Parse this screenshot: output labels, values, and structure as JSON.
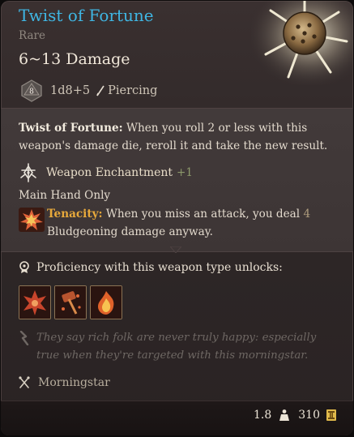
{
  "item": {
    "name": "Twist of Fortune",
    "rarity": "Rare",
    "damage": "6~13 Damage",
    "die_label": "8",
    "roll": "1d8+5",
    "damage_type": "Piercing"
  },
  "passive": {
    "name": "Twist of Fortune:",
    "text": "When you roll 2 or less with this weapon's damage die, reroll it and take the new result."
  },
  "enchantment": {
    "label": "Weapon Enchantment",
    "bonus": "+1"
  },
  "restriction": "Main Hand Only",
  "tenacity": {
    "name": "Tenacity:",
    "text_a": "When you miss an attack, you deal",
    "amount": "4",
    "text_b": "Bludgeoning damage",
    "text_c": "anyway."
  },
  "proficiency": {
    "label": "Proficiency with this weapon type unlocks:",
    "actions": [
      "brutal-strike-icon",
      "bludgeon-icon",
      "fire-burst-icon"
    ]
  },
  "flavor": "They say rich folk are never truly happy: especially true when they're targeted with this morningstar.",
  "weapon_type": "Morningstar",
  "footer": {
    "weight": "1.8",
    "value": "310"
  },
  "colors": {
    "title": "#3fb6e3",
    "highlight": "#e8a93b",
    "enchant_bonus": "#8e9a6c",
    "action_border": "#8b7354"
  }
}
